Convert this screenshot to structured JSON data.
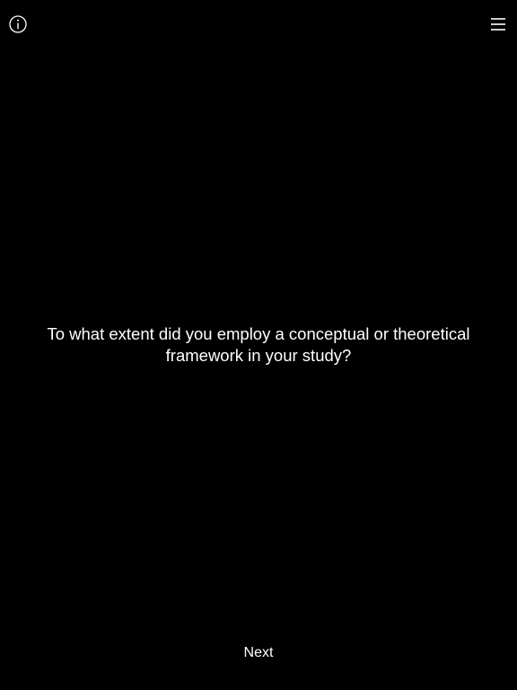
{
  "header": {
    "info_icon": "info-circle-icon",
    "menu_icon": "hamburger-menu-icon"
  },
  "question": {
    "text": "To what extent did you employ a conceptual or theoretical framework in your study?"
  },
  "footer": {
    "next_label": "Next"
  },
  "colors": {
    "background": "#000000",
    "text": "#ffffff"
  }
}
